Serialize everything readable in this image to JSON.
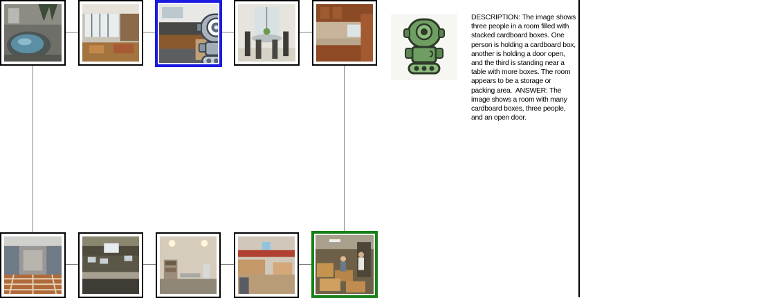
{
  "graph": {
    "top_row": [
      {
        "name": "hot-tub-room",
        "state": "normal"
      },
      {
        "name": "lobby-lounge",
        "state": "normal"
      },
      {
        "name": "office-workroom",
        "state": "current"
      },
      {
        "name": "dining-room",
        "state": "normal"
      },
      {
        "name": "kitchen",
        "state": "normal"
      }
    ],
    "bottom_row": [
      {
        "name": "locker-room",
        "state": "normal"
      },
      {
        "name": "computer-lab",
        "state": "normal"
      },
      {
        "name": "utility-room",
        "state": "normal"
      },
      {
        "name": "stockroom",
        "state": "normal"
      },
      {
        "name": "storage-room-with-boxes",
        "state": "goal"
      }
    ],
    "colors": {
      "current_border": "#1a1ae0",
      "goal_border": "#188018",
      "edge": "#808080"
    }
  },
  "agent": {
    "icon": "robot-icon",
    "color": "#6e9e62"
  },
  "description_text": "DESCRIPTION: The image shows three people in a room filled with stacked cardboard boxes. One person is holding a cardboard box, another is holding a door open, and the third is standing near a table with more boxes. The room appears to be a storage or packing area.  ANSWER: The image shows a room with many cardboard boxes, three people, and an open door."
}
